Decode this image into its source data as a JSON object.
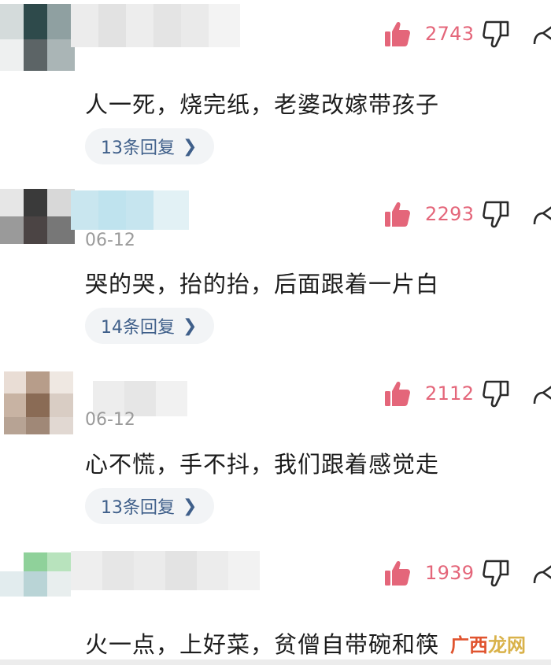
{
  "comments": [
    {
      "date": "",
      "content": "人一死，烧完纸，老婆改嫁带孩子",
      "likes": "2743",
      "replies": "13条回复"
    },
    {
      "date": "06-12",
      "content": "哭的哭，抬的抬，后面跟着一片白",
      "likes": "2293",
      "replies": "14条回复"
    },
    {
      "date": "06-12",
      "content": "心不慌，手不抖，我们跟着感觉走",
      "likes": "2112",
      "replies": "13条回复"
    },
    {
      "date": "",
      "content": "火一点，上好菜，贫僧自带碗和筷",
      "likes": "1939",
      "replies": ""
    }
  ],
  "icons": {
    "like": "thumb-up-icon",
    "dislike": "thumb-down-icon",
    "share": "share-icon",
    "reply_chevron": "chevron-right-icon"
  },
  "colors": {
    "like_red": "#e4667a",
    "reply_text": "#3f5f8a",
    "date_gray": "#9a9a9a"
  },
  "watermark": {
    "part1": "广西",
    "part2": "龙网"
  }
}
